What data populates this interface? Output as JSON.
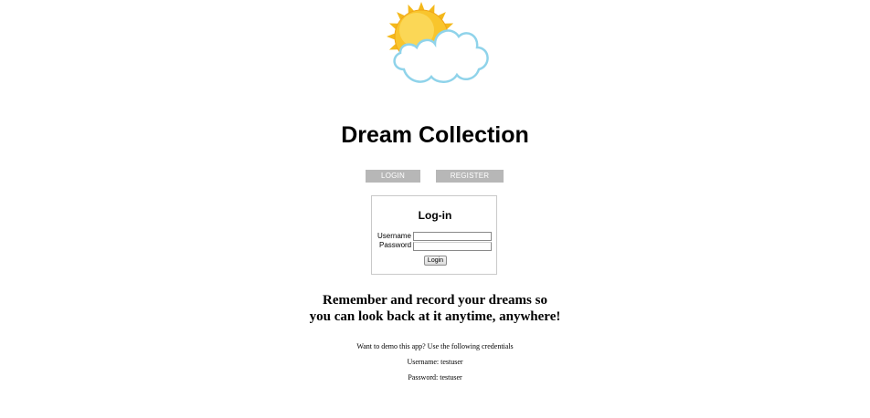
{
  "app": {
    "title": "Dream Collection"
  },
  "logo": {
    "icon": "sun-behind-cloud-icon",
    "colors": {
      "sun": "#f9c52c",
      "sun_rays": "#f4b81a",
      "cloud": "#ffffff",
      "cloud_outline": "#8fd3ea"
    }
  },
  "nav": {
    "login_label": "LOGIN",
    "register_label": "REGISTER",
    "button_color": "#b7b7b7"
  },
  "login_form": {
    "heading": "Log-in",
    "username_label": "Username",
    "password_label": "Password",
    "username_value": "",
    "password_value": "",
    "submit_label": "Login"
  },
  "tagline": {
    "line1": "Remember and record your dreams so",
    "line2": "you can look back at it anytime, anywhere!"
  },
  "demo": {
    "intro": "Want to demo this app? Use the following credentials",
    "username": "Username: testuser",
    "password": "Password: testuser"
  }
}
